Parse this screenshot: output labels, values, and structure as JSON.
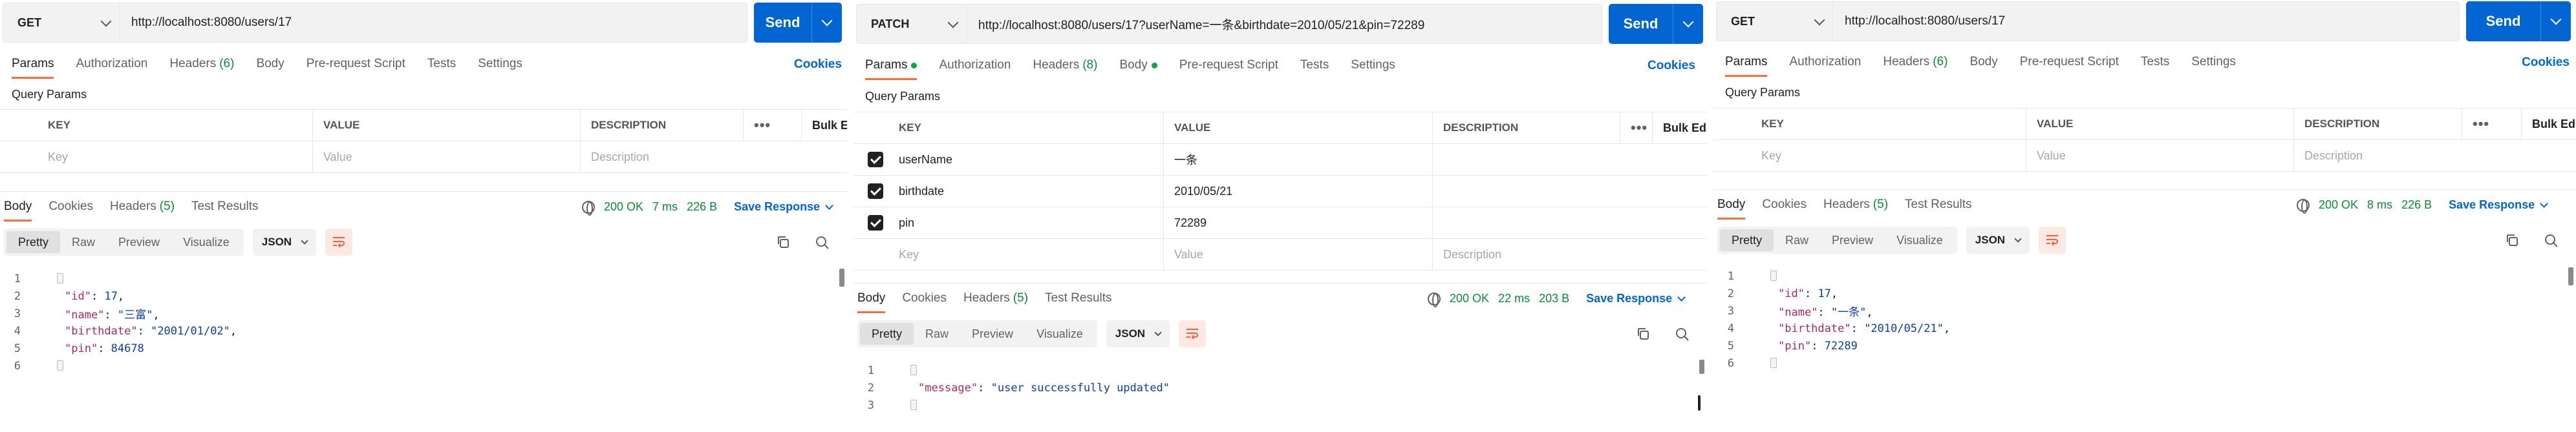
{
  "panels": [
    {
      "method": "GET",
      "url": "http://localhost:8080/users/17",
      "send_label": "Send",
      "tabs": [
        {
          "label": "Params",
          "count": "",
          "dot": false,
          "active": true
        },
        {
          "label": "Authorization",
          "count": "",
          "dot": false,
          "active": false
        },
        {
          "label": "Headers",
          "count": "(6)",
          "dot": false,
          "active": false
        },
        {
          "label": "Body",
          "count": "",
          "dot": false,
          "active": false
        },
        {
          "label": "Pre-request Script",
          "count": "",
          "dot": false,
          "active": false
        },
        {
          "label": "Tests",
          "count": "",
          "dot": false,
          "active": false
        },
        {
          "label": "Settings",
          "count": "",
          "dot": false,
          "active": false
        }
      ],
      "cookies": "Cookies",
      "query_params_title": "Query Params",
      "table_headers": {
        "key": "KEY",
        "value": "VALUE",
        "description": "DESCRIPTION",
        "bulk_edit": "Bulk Edit"
      },
      "params": [],
      "placeholders": {
        "key": "Key",
        "value": "Value",
        "description": "Description"
      },
      "resp_tabs": [
        {
          "label": "Body",
          "count": "",
          "active": true
        },
        {
          "label": "Cookies",
          "count": "",
          "active": false
        },
        {
          "label": "Headers",
          "count": "(5)",
          "active": false
        },
        {
          "label": "Test Results",
          "count": "",
          "active": false
        }
      ],
      "status": "200 OK",
      "time": "7 ms",
      "size": "226 B",
      "save_response": "Save Response",
      "views": [
        "Pretty",
        "Raw",
        "Preview",
        "Visualize"
      ],
      "format": "JSON",
      "code_lines": [
        {
          "num": "1",
          "text": "{"
        },
        {
          "num": "2",
          "key": "\"id\"",
          "sep": ": ",
          "val": "17",
          "type": "n",
          "tail": ","
        },
        {
          "num": "3",
          "key": "\"name\"",
          "sep": ": ",
          "val": "\"三富\"",
          "type": "s",
          "tail": ","
        },
        {
          "num": "4",
          "key": "\"birthdate\"",
          "sep": ": ",
          "val": "\"2001/01/02\"",
          "type": "s",
          "tail": ","
        },
        {
          "num": "5",
          "key": "\"pin\"",
          "sep": ": ",
          "val": "84678",
          "type": "n",
          "tail": ""
        },
        {
          "num": "6",
          "text": "}"
        }
      ]
    },
    {
      "method": "PATCH",
      "url": "http://localhost:8080/users/17?userName=一条&birthdate=2010/05/21&pin=72289",
      "send_label": "Send",
      "tabs": [
        {
          "label": "Params",
          "count": "",
          "dot": true,
          "active": true
        },
        {
          "label": "Authorization",
          "count": "",
          "dot": false,
          "active": false
        },
        {
          "label": "Headers",
          "count": "(8)",
          "dot": false,
          "active": false
        },
        {
          "label": "Body",
          "count": "",
          "dot": true,
          "active": false
        },
        {
          "label": "Pre-request Script",
          "count": "",
          "dot": false,
          "active": false
        },
        {
          "label": "Tests",
          "count": "",
          "dot": false,
          "active": false
        },
        {
          "label": "Settings",
          "count": "",
          "dot": false,
          "active": false
        }
      ],
      "cookies": "Cookies",
      "query_params_title": "Query Params",
      "table_headers": {
        "key": "KEY",
        "value": "VALUE",
        "description": "DESCRIPTION",
        "bulk_edit": "Bulk Edit"
      },
      "params": [
        {
          "key": "userName",
          "value": "一条"
        },
        {
          "key": "birthdate",
          "value": "2010/05/21"
        },
        {
          "key": "pin",
          "value": "72289"
        }
      ],
      "placeholders": {
        "key": "Key",
        "value": "Value",
        "description": "Description"
      },
      "resp_tabs": [
        {
          "label": "Body",
          "count": "",
          "active": true
        },
        {
          "label": "Cookies",
          "count": "",
          "active": false
        },
        {
          "label": "Headers",
          "count": "(5)",
          "active": false
        },
        {
          "label": "Test Results",
          "count": "",
          "active": false
        }
      ],
      "status": "200 OK",
      "time": "22 ms",
      "size": "203 B",
      "save_response": "Save Response",
      "views": [
        "Pretty",
        "Raw",
        "Preview",
        "Visualize"
      ],
      "format": "JSON",
      "code_lines": [
        {
          "num": "1",
          "text": "{"
        },
        {
          "num": "2",
          "key": "\"message\"",
          "sep": ": ",
          "val": "\"user successfully updated\"",
          "type": "s",
          "tail": ""
        },
        {
          "num": "3",
          "text": "}"
        }
      ]
    },
    {
      "method": "GET",
      "url": "http://localhost:8080/users/17",
      "send_label": "Send",
      "tabs": [
        {
          "label": "Params",
          "count": "",
          "dot": false,
          "active": true
        },
        {
          "label": "Authorization",
          "count": "",
          "dot": false,
          "active": false
        },
        {
          "label": "Headers",
          "count": "(6)",
          "dot": false,
          "active": false
        },
        {
          "label": "Body",
          "count": "",
          "dot": false,
          "active": false
        },
        {
          "label": "Pre-request Script",
          "count": "",
          "dot": false,
          "active": false
        },
        {
          "label": "Tests",
          "count": "",
          "dot": false,
          "active": false
        },
        {
          "label": "Settings",
          "count": "",
          "dot": false,
          "active": false
        }
      ],
      "cookies": "Cookies",
      "query_params_title": "Query Params",
      "table_headers": {
        "key": "KEY",
        "value": "VALUE",
        "description": "DESCRIPTION",
        "bulk_edit": "Bulk Edit"
      },
      "params": [],
      "placeholders": {
        "key": "Key",
        "value": "Value",
        "description": "Description"
      },
      "resp_tabs": [
        {
          "label": "Body",
          "count": "",
          "active": true
        },
        {
          "label": "Cookies",
          "count": "",
          "active": false
        },
        {
          "label": "Headers",
          "count": "(5)",
          "active": false
        },
        {
          "label": "Test Results",
          "count": "",
          "active": false
        }
      ],
      "status": "200 OK",
      "time": "8 ms",
      "size": "226 B",
      "save_response": "Save Response",
      "views": [
        "Pretty",
        "Raw",
        "Preview",
        "Visualize"
      ],
      "format": "JSON",
      "code_lines": [
        {
          "num": "1",
          "text": "{"
        },
        {
          "num": "2",
          "key": "\"id\"",
          "sep": ": ",
          "val": "17",
          "type": "n",
          "tail": ","
        },
        {
          "num": "3",
          "key": "\"name\"",
          "sep": ": ",
          "val": "\"一条\"",
          "type": "s",
          "tail": ","
        },
        {
          "num": "4",
          "key": "\"birthdate\"",
          "sep": ": ",
          "val": "\"2010/05/21\"",
          "type": "s",
          "tail": ","
        },
        {
          "num": "5",
          "key": "\"pin\"",
          "sep": ": ",
          "val": "72289",
          "type": "n",
          "tail": ""
        },
        {
          "num": "6",
          "text": "}"
        }
      ]
    }
  ]
}
